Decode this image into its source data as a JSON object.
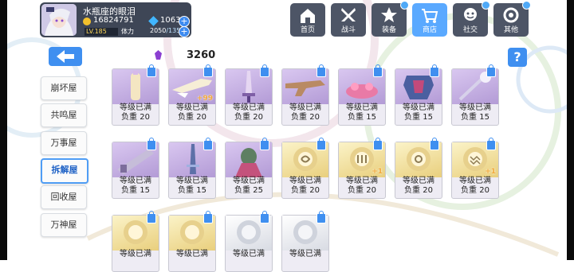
{
  "player": {
    "name": "水瓶座的眼泪",
    "gold": "16824791",
    "crystals": "1063",
    "level": "LV.185",
    "stamina_label": "体力",
    "stamina_value": "2050",
    "stamina_max": "/135"
  },
  "nav": [
    {
      "label": "首页",
      "icon": "home-icon",
      "active": false,
      "badge": false
    },
    {
      "label": "战斗",
      "icon": "battle-icon",
      "active": false,
      "badge": false
    },
    {
      "label": "装备",
      "icon": "equipment-icon",
      "active": false,
      "badge": true
    },
    {
      "label": "商店",
      "icon": "shop-icon",
      "active": true,
      "badge": false
    },
    {
      "label": "社交",
      "icon": "social-icon",
      "active": false,
      "badge": true
    },
    {
      "label": "其他",
      "icon": "other-icon",
      "active": false,
      "badge": true
    }
  ],
  "resource": {
    "icon": "purple-material-icon",
    "value": "3260"
  },
  "help_label": "?",
  "sidebar": [
    {
      "label": "崩坏屋",
      "active": false
    },
    {
      "label": "共鸣屋",
      "active": false
    },
    {
      "label": "万事屋",
      "active": false
    },
    {
      "label": "拆解屋",
      "active": true
    },
    {
      "label": "回收屋",
      "active": false
    },
    {
      "label": "万神屋",
      "active": false
    }
  ],
  "cards": [
    {
      "status": "等级已满",
      "load": "负重 20",
      "style": "purple",
      "bonus": ""
    },
    {
      "status": "等级已满",
      "load": "负重 20",
      "style": "purple",
      "bonus": "+99"
    },
    {
      "status": "等级已满",
      "load": "负重 20",
      "style": "purple",
      "bonus": ""
    },
    {
      "status": "等级已满",
      "load": "负重 20",
      "style": "purple",
      "bonus": ""
    },
    {
      "status": "等级已满",
      "load": "负重 15",
      "style": "purple",
      "bonus": ""
    },
    {
      "status": "等级已满",
      "load": "负重 15",
      "style": "purple",
      "bonus": ""
    },
    {
      "status": "等级已满",
      "load": "负重 15",
      "style": "purple",
      "bonus": ""
    },
    {
      "status": "等级已满",
      "load": "负重 15",
      "style": "purple",
      "bonus": ""
    },
    {
      "status": "等级已满",
      "load": "负重 15",
      "style": "purple",
      "bonus": ""
    },
    {
      "status": "等级已满",
      "load": "负重 25",
      "style": "purple",
      "bonus": ""
    },
    {
      "status": "等级已满",
      "load": "负重 20",
      "style": "gold",
      "bonus": ""
    },
    {
      "status": "等级已满",
      "load": "负重 20",
      "style": "gold",
      "bonus": "+1"
    },
    {
      "status": "等级已满",
      "load": "负重 20",
      "style": "gold",
      "bonus": ""
    },
    {
      "status": "等级已满",
      "load": "负重 20",
      "style": "gold",
      "bonus": "+1"
    },
    {
      "status": "等级已满",
      "load": "",
      "style": "gold",
      "bonus": ""
    },
    {
      "status": "等级已满",
      "load": "",
      "style": "gold",
      "bonus": ""
    },
    {
      "status": "等级已满",
      "load": "",
      "style": "silver",
      "bonus": ""
    },
    {
      "status": "等级已满",
      "load": "",
      "style": "silver",
      "bonus": ""
    }
  ]
}
